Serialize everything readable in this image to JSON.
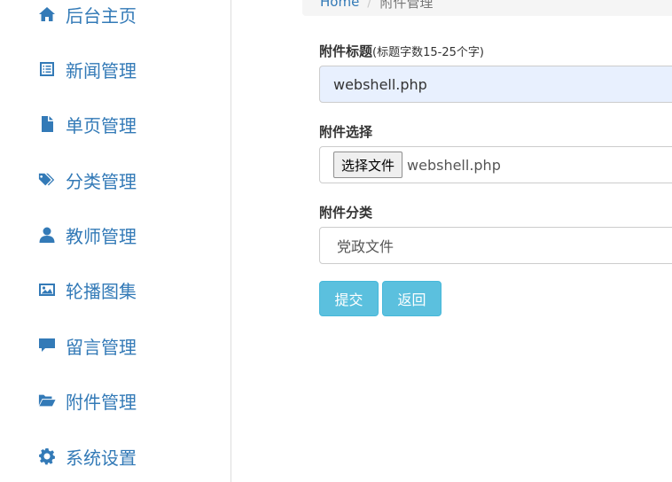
{
  "sidebar": {
    "items": [
      {
        "label": "后台主页",
        "icon": "home-icon"
      },
      {
        "label": "新闻管理",
        "icon": "list-alt-icon"
      },
      {
        "label": "单页管理",
        "icon": "file-icon"
      },
      {
        "label": "分类管理",
        "icon": "tags-icon"
      },
      {
        "label": "教师管理",
        "icon": "user-icon"
      },
      {
        "label": "轮播图集",
        "icon": "picture-icon"
      },
      {
        "label": "留言管理",
        "icon": "comment-icon"
      },
      {
        "label": "附件管理",
        "icon": "folder-open-icon"
      },
      {
        "label": "系统设置",
        "icon": "cog-icon"
      }
    ]
  },
  "breadcrumb": {
    "home": "Home",
    "separator": "/",
    "current": "附件管理"
  },
  "form": {
    "title_label": "附件标题",
    "title_hint": "(标题字数15-25个字)",
    "title_value": "webshell.php",
    "file_label": "附件选择",
    "file_button": "选择文件",
    "file_name": "webshell.php",
    "category_label": "附件分类",
    "category_value": "党政文件",
    "submit_label": "提交",
    "back_label": "返回"
  },
  "colors": {
    "accent": "#337ab7",
    "button": "#5bc0de",
    "autofill": "#e8f0fe"
  }
}
